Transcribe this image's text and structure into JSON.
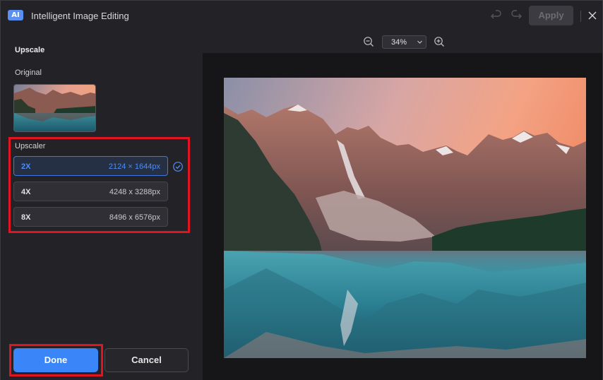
{
  "titlebar": {
    "badge": "AI",
    "title": "Intelligent Image Editing",
    "apply_label": "Apply"
  },
  "left_panel": {
    "section_title": "Upscale",
    "original_label": "Original",
    "upscaler_label": "Upscaler",
    "options": [
      {
        "name": "2X",
        "size": "2124 × 1644px",
        "selected": true
      },
      {
        "name": "4X",
        "size": "4248 x 3288px",
        "selected": false
      },
      {
        "name": "8X",
        "size": "8496 x 6576px",
        "selected": false
      }
    ],
    "done_label": "Done",
    "cancel_label": "Cancel"
  },
  "preview": {
    "zoom_value": "34%"
  },
  "colors": {
    "accent": "#3a85f8",
    "highlight_outline": "#e01521"
  },
  "icons": [
    "ai-badge",
    "undo-icon",
    "redo-icon",
    "close-icon",
    "check-icon",
    "zoom-out-icon",
    "zoom-in-icon",
    "chevron-down-icon"
  ]
}
